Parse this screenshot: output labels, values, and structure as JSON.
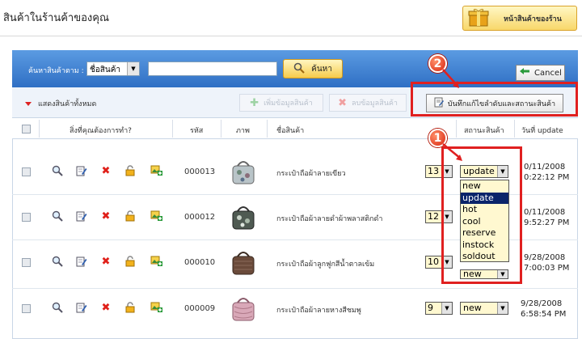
{
  "header": {
    "page_title": "สินค้าในร้านค้าของคุณ",
    "shop_button_label": "หน้าสินค้าของร้าน"
  },
  "search": {
    "label": "ค้นหาสินค้าตาม :",
    "field_select": "ชื่อสินค้า",
    "input_value": "",
    "search_button": "ค้นหา",
    "cancel_button": "Cancel"
  },
  "toolbar": {
    "show_all": "แสดงสินค้าทั้งหมด",
    "add_button": "เพิ่มข้อมูลสินค้า",
    "delete_button": "ลบข้อมูลสินค้า",
    "save_button": "บันทึกแก้ไขลำดับและสถานะสินค้า"
  },
  "table": {
    "headers": {
      "actions": "สิ่งที่คุณต้องการทำ?",
      "code": "รหัส",
      "image": "ภาพ",
      "name": "ชื่อสินค้า",
      "status": "สถานะสินค้า",
      "date": "วันที่ update"
    },
    "rows": [
      {
        "code": "000013",
        "name": "กระเป๋าถือผ้าลายเขียว",
        "order": "13",
        "status": "update",
        "date1": "0/11/2008",
        "date2": "0:22:12 PM"
      },
      {
        "code": "000012",
        "name": "กระเป๋าถือผ้าลายดำผ้าพลาสติกดำ",
        "order": "12",
        "status": "new",
        "date1": "0/11/2008",
        "date2": "9:52:27 PM"
      },
      {
        "code": "000010",
        "name": "กระเป๋าถือผ้าลูกฟูกสีน้ำตาลเข้ม",
        "order": "10",
        "status": "new",
        "date1": "9/28/2008",
        "date2": "7:00:03 PM"
      },
      {
        "code": "000009",
        "name": "กระเป๋าถือผ้าลายหางสีชมพู",
        "order": "9",
        "status": "new",
        "date1": "9/28/2008",
        "date2": "6:58:54 PM"
      }
    ]
  },
  "status_dropdown": {
    "options": [
      "new",
      "update",
      "hot",
      "cool",
      "reserve",
      "instock",
      "soldout"
    ],
    "selected": "update"
  },
  "annotations": {
    "badge1": "1",
    "badge2": "2"
  },
  "colors": {
    "accent_blue": "#2f6fc4",
    "highlight_red": "#e02020",
    "button_gold": "#f6cb4c"
  }
}
